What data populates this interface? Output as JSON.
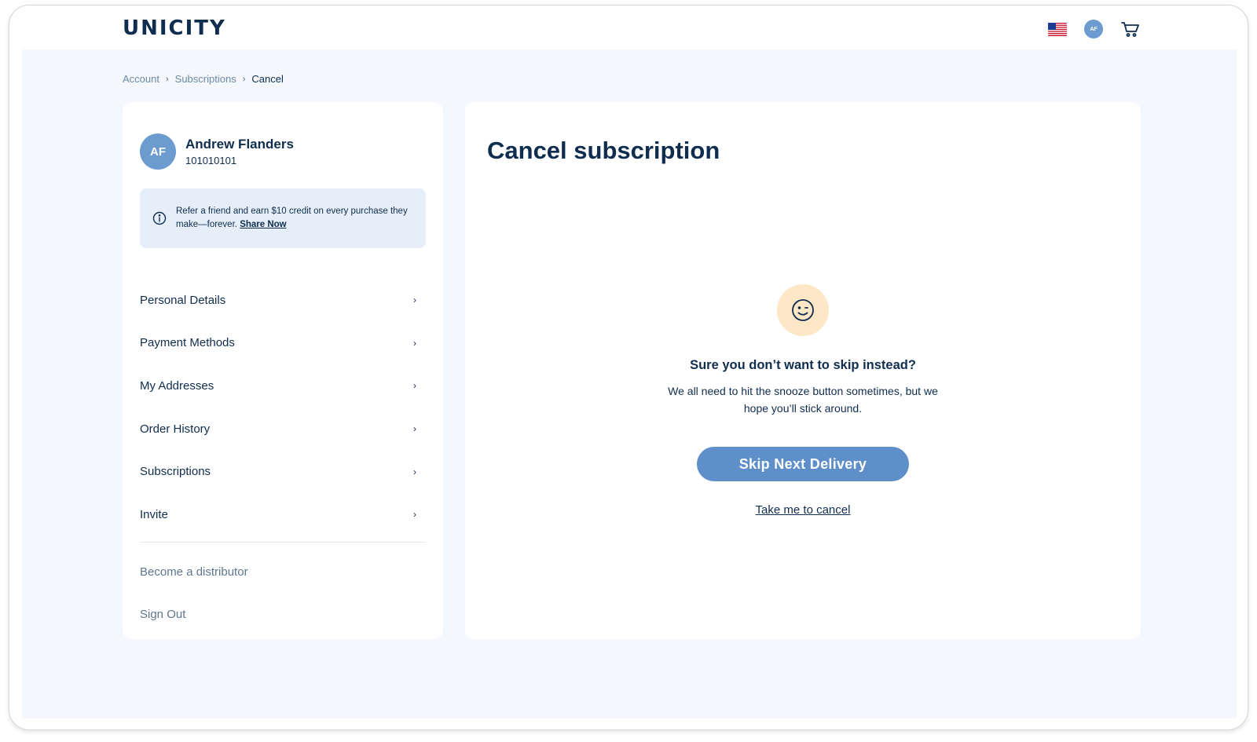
{
  "header": {
    "logo": "UNICITY",
    "avatar_initials": "AF",
    "flag_icon": "us-flag-icon",
    "cart_icon": "cart-icon"
  },
  "breadcrumb": {
    "items": [
      "Account",
      "Subscriptions",
      "Cancel"
    ],
    "separator": "›"
  },
  "sidebar": {
    "avatar_initials": "AF",
    "user_name": "Andrew Flanders",
    "user_id": "101010101",
    "referral": {
      "text": "Refer a friend and earn $10 credit on every purchase they make—forever.",
      "link": "Share Now"
    },
    "nav_items": [
      {
        "label": "Personal Details"
      },
      {
        "label": "Payment Methods"
      },
      {
        "label": "My Addresses"
      },
      {
        "label": "Order History"
      },
      {
        "label": "Subscriptions"
      },
      {
        "label": "Invite"
      }
    ],
    "chevron": "›",
    "secondary_items": [
      {
        "label": "Become a distributor"
      },
      {
        "label": "Sign Out"
      }
    ]
  },
  "main": {
    "title": "Cancel subscription",
    "question": "Sure you don’t want to skip instead?",
    "description": "We all need to hit the snooze button sometimes, but we hope you’ll stick around.",
    "skip_button": "Skip Next Delivery",
    "cancel_link": "Take me to cancel"
  },
  "colors": {
    "primary_text": "#0f2d4f",
    "accent": "#5e8fc8",
    "page_bg": "#f4f7fb",
    "referral_bg": "#e6eff9",
    "emoji_bg": "#fde7c6"
  }
}
